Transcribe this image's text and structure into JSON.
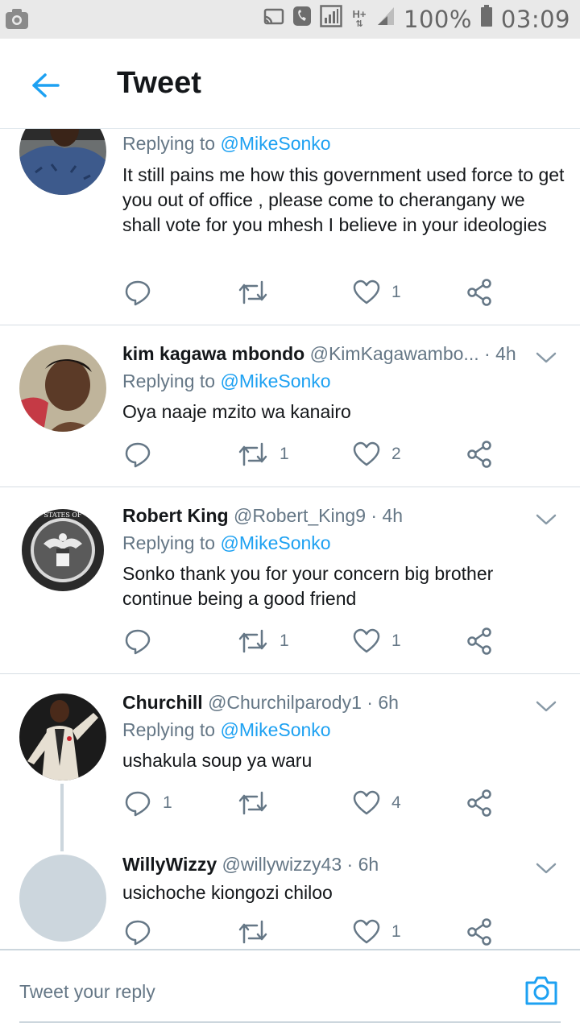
{
  "status_bar": {
    "battery": "100%",
    "time": "03:09",
    "network": "H+"
  },
  "app_bar": {
    "title": "Tweet",
    "back_icon": "arrow-left-icon"
  },
  "tweets": [
    {
      "name": "",
      "handle": "",
      "time": "",
      "replying_prefix": "Replying to",
      "replying_to": "@MikeSonko",
      "text": "It still pains me how this government used force to get you out of office , please come to cherangany we shall vote for you mhesh I believe in your ideologies",
      "replies": "",
      "retweets": "",
      "likes": "1"
    },
    {
      "name": "kim kagawa mbondo",
      "handle": "@KimKagawambo...",
      "time": "4h",
      "replying_prefix": "Replying to",
      "replying_to": "@MikeSonko",
      "text": "Oya naaje mzito wa kanairo",
      "replies": "",
      "retweets": "1",
      "likes": "2"
    },
    {
      "name": "Robert King",
      "handle": "@Robert_King9",
      "time": "4h",
      "replying_prefix": "Replying to",
      "replying_to": "@MikeSonko",
      "text": "Sonko thank you for your concern big brother continue being a good friend",
      "replies": "",
      "retweets": "1",
      "likes": "1"
    },
    {
      "name": "Churchill",
      "handle": "@Churchilparody1",
      "time": "6h",
      "replying_prefix": "Replying to",
      "replying_to": "@MikeSonko",
      "text": "ushakula soup ya waru",
      "replies": "1",
      "retweets": "",
      "likes": "4"
    },
    {
      "name": "WillyWizzy",
      "handle": "@willywizzy43",
      "time": "6h",
      "text": "usichoche kiongozi  chiloo",
      "replies": "",
      "retweets": "",
      "likes": "1"
    }
  ],
  "reply_bar": {
    "placeholder": "Tweet your reply"
  },
  "colors": {
    "accent": "#1da1f2",
    "secondary_text": "#657786",
    "divider": "#e1e8ed"
  }
}
